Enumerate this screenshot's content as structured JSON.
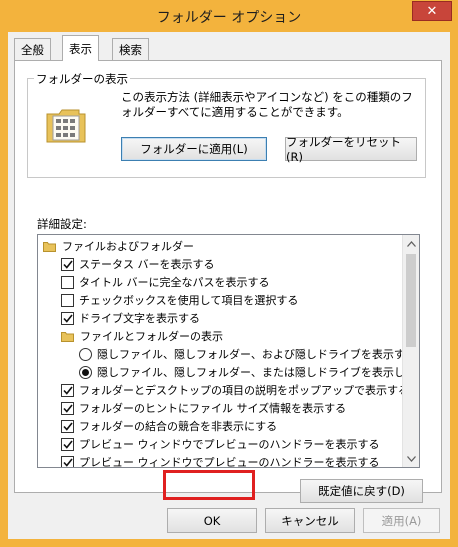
{
  "window": {
    "title": "フォルダー オプション",
    "close_glyph": "✕"
  },
  "tabs": [
    {
      "label": "全般",
      "active": false
    },
    {
      "label": "表示",
      "active": true
    },
    {
      "label": "検索",
      "active": false
    }
  ],
  "folder_view": {
    "legend": "フォルダーの表示",
    "description": "この表示方法 (詳細表示やアイコンなど) をこの種類のフォルダーすべてに適用することができます。",
    "apply_label": "フォルダーに適用(L)",
    "reset_label": "フォルダーをリセット(R)"
  },
  "advanced": {
    "label": "詳細設定:",
    "items": [
      {
        "type": "folder",
        "level": 0,
        "text": "ファイルおよびフォルダー"
      },
      {
        "type": "checkbox",
        "level": 1,
        "checked": true,
        "text": "ステータス バーを表示する"
      },
      {
        "type": "checkbox",
        "level": 1,
        "checked": false,
        "text": "タイトル バーに完全なパスを表示する"
      },
      {
        "type": "checkbox",
        "level": 1,
        "checked": false,
        "text": "チェックボックスを使用して項目を選択する"
      },
      {
        "type": "checkbox",
        "level": 1,
        "checked": true,
        "text": "ドライブ文字を表示する"
      },
      {
        "type": "folder",
        "level": 1,
        "text": "ファイルとフォルダーの表示"
      },
      {
        "type": "radio",
        "level": 2,
        "checked": false,
        "text": "隠しファイル、隠しフォルダー、および隠しドライブを表示する"
      },
      {
        "type": "radio",
        "level": 2,
        "checked": true,
        "text": "隠しファイル、隠しフォルダー、または隠しドライブを表示しない"
      },
      {
        "type": "checkbox",
        "level": 1,
        "checked": true,
        "text": "フォルダーとデスクトップの項目の説明をポップアップで表示する"
      },
      {
        "type": "checkbox",
        "level": 1,
        "checked": true,
        "text": "フォルダーのヒントにファイル サイズ情報を表示する"
      },
      {
        "type": "checkbox",
        "level": 1,
        "checked": true,
        "text": "フォルダーの結合の競合を非表示にする"
      },
      {
        "type": "checkbox",
        "level": 1,
        "checked": true,
        "text": "プレビュー ウィンドウでプレビューのハンドラーを表示する"
      },
      {
        "type": "checkbox",
        "level": 1,
        "checked": true,
        "text": "プレビュー ウィンドウでプレビューのハンドラーを表示する"
      }
    ],
    "restore_defaults_label": "既定値に戻す(D)"
  },
  "footer": {
    "ok_label": "OK",
    "cancel_label": "キャンセル",
    "apply_label": "適用(A)"
  },
  "colors": {
    "title_bar": "#f3b33d",
    "close_button": "#c8453a",
    "highlight_box": "#e02020",
    "folder_icon": "#e8c25a"
  }
}
